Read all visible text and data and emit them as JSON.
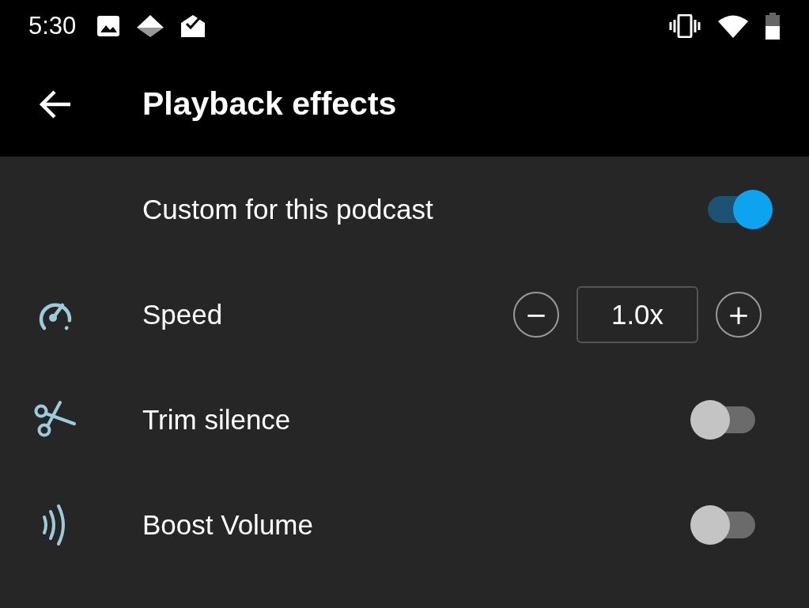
{
  "status_bar": {
    "time": "5:30"
  },
  "toolbar": {
    "title": "Playback effects"
  },
  "settings": [
    {
      "kind": "switch",
      "label": "Custom for this podcast",
      "on": true
    },
    {
      "kind": "stepper",
      "label": "Speed",
      "minus": "−",
      "value": "1.0x",
      "plus": "+"
    },
    {
      "kind": "switch",
      "label": "Trim silence",
      "on": false
    },
    {
      "kind": "switch",
      "label": "Boost Volume",
      "on": false
    }
  ]
}
